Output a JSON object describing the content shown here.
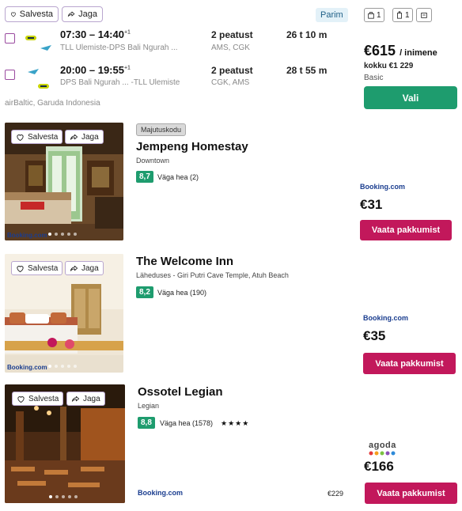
{
  "flight": {
    "save_label": "Salvesta",
    "share_label": "Jaga",
    "best_badge": "Parim",
    "luggage": [
      {
        "icon": "personal-bag-icon",
        "count": "1"
      },
      {
        "icon": "carry-on-icon",
        "count": "1"
      },
      {
        "icon": "checked-bag-icon",
        "count": ""
      }
    ],
    "legs": [
      {
        "depart": "07:30",
        "arrive": "14:40",
        "dayplus": "+1",
        "route": "TLL Ulemiste-DPS Bali Ngurah ...",
        "stops": "2 peatust",
        "via": "AMS, CGK",
        "duration": "26 t 10 m"
      },
      {
        "depart": "20:00",
        "arrive": "19:55",
        "dayplus": "+1",
        "route": "DPS Bali Ngurah ... -TLL Ulemiste",
        "stops": "2 peatust",
        "via": "CGK, AMS",
        "duration": "28 t 55 m"
      }
    ],
    "carriers": "airBaltic, Garuda Indonesia",
    "price": "€615",
    "per_person": "/ inimene",
    "total": "kokku €1 229",
    "fare": "Basic",
    "select_label": "Vali"
  },
  "hotels": [
    {
      "type": "Majutuskodu",
      "name": "Jempeng Homestay",
      "location": "Downtown",
      "score": "8,7",
      "rating": "Väga hea (2)",
      "stars": "",
      "image_brand": "Booking.com",
      "provider": "Booking.com",
      "price": "€31",
      "extra_provider": "",
      "extra_price": "",
      "cta": "Vaata pakkumist",
      "save_label": "Salvesta",
      "share_label": "Jaga"
    },
    {
      "type": "",
      "name": "The Welcome Inn",
      "location": "Läheduses - Giri Putri Cave Temple, Atuh Beach",
      "score": "8,2",
      "rating": "Väga hea (190)",
      "stars": "",
      "image_brand": "Booking.com",
      "provider": "Booking.com",
      "price": "€35",
      "extra_provider": "",
      "extra_price": "",
      "cta": "Vaata pakkumist",
      "save_label": "Salvesta",
      "share_label": "Jaga"
    },
    {
      "type": "",
      "name": "Ossotel Legian",
      "location": "Legian",
      "score": "8,8",
      "rating": "Väga hea (1578)",
      "stars": "★★★★",
      "image_brand": "",
      "provider": "agoda",
      "price": "€166",
      "extra_provider": "Booking.com",
      "extra_price": "€229",
      "cta": "Vaata pakkumist",
      "save_label": "Salvesta",
      "share_label": "Jaga"
    }
  ],
  "colors": {
    "green": "#1e9c6e",
    "pink": "#c2185b",
    "chip_border": "#b9a6cf",
    "booking_blue": "#1a3d8f"
  }
}
